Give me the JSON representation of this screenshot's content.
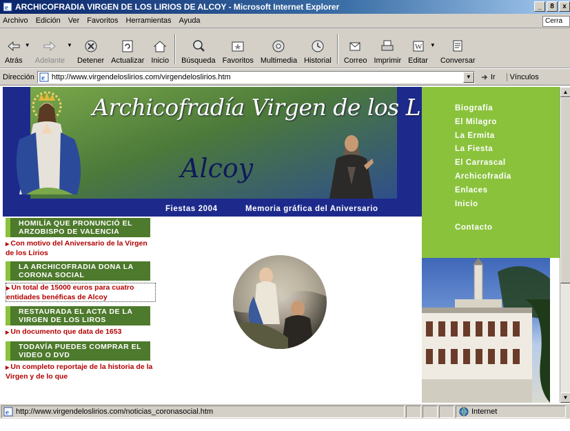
{
  "window": {
    "title": "ARCHICOFRADIA VIRGEN DE LOS LIRIOS DE ALCOY - Microsoft Internet Explorer",
    "controls": [
      "_",
      "8",
      "x"
    ]
  },
  "menubar": {
    "items": [
      "Archivo",
      "Edición",
      "Ver",
      "Favoritos",
      "Herramientas",
      "Ayuda"
    ],
    "close_field": "Cerra"
  },
  "toolbar": {
    "buttons": [
      {
        "label": "Atrás",
        "icon": "back-arrow-icon"
      },
      {
        "label": "Adelante",
        "icon": "forward-arrow-icon",
        "disabled": true
      },
      {
        "label": "Detener",
        "icon": "stop-icon"
      },
      {
        "label": "Actualizar",
        "icon": "refresh-icon"
      },
      {
        "label": "Inicio",
        "icon": "home-icon"
      },
      {
        "label": "Búsqueda",
        "icon": "search-icon"
      },
      {
        "label": "Favoritos",
        "icon": "favorites-icon"
      },
      {
        "label": "Multimedia",
        "icon": "media-icon"
      },
      {
        "label": "Historial",
        "icon": "history-icon"
      },
      {
        "label": "Correo",
        "icon": "mail-icon"
      },
      {
        "label": "Imprimir",
        "icon": "print-icon"
      },
      {
        "label": "Editar",
        "icon": "edit-icon"
      },
      {
        "label": "Conversar",
        "icon": "discuss-icon"
      }
    ]
  },
  "addressbar": {
    "label": "Dirección",
    "url": "http://www.virgendeloslirios.com/virgendeloslirios.htm",
    "go_label": "Ir",
    "links_label": "Vínculos"
  },
  "page": {
    "banner": {
      "title": "Archicofradía Virgen de los Lirios",
      "subtitle": "Alcoy",
      "strip_left": "Fiestas 2004",
      "strip_right": "Memoria gráfica del Aniversario"
    },
    "nav": [
      "Biografía",
      "El Milagro",
      "La Ermita",
      "La Fiesta",
      "El Carrascal",
      "Archicofradía",
      "Enlaces",
      "Inicio"
    ],
    "contact": "Contacto",
    "news": [
      {
        "heading": "HOMILÍA QUE PRONUNCIÓ EL ARZOBISPO DE VALENCIA",
        "link": "Con motivo del Aniversario de la Virgen de los Lirios"
      },
      {
        "heading": "LA ARCHICOFRADIA DONA LA CORONA SOCIAL",
        "link": "Un total de 15000 euros para cuatro entidades benéficas de Alcoy"
      },
      {
        "heading": "RESTAURADA EL ACTA DE LA VIRGEN DE LOS LIROS",
        "link": "Un documento que data de 1653"
      },
      {
        "heading": "TODAVÍA PUEDES COMPRAR EL VIDEO O DVD",
        "link": "Un completo reportaje de la historia de la Virgen y de lo que"
      }
    ]
  },
  "statusbar": {
    "url": "http://www.virgendeloslirios.com/noticias_coronasocial.htm",
    "zone": "Internet"
  },
  "colors": {
    "title_bar": "#0a246a",
    "chrome": "#d4d0c8",
    "banner_blue": "#1d2a8c",
    "menu_green": "#8ac23c",
    "news_green": "#4d7a2c",
    "link_red": "#b20000"
  }
}
